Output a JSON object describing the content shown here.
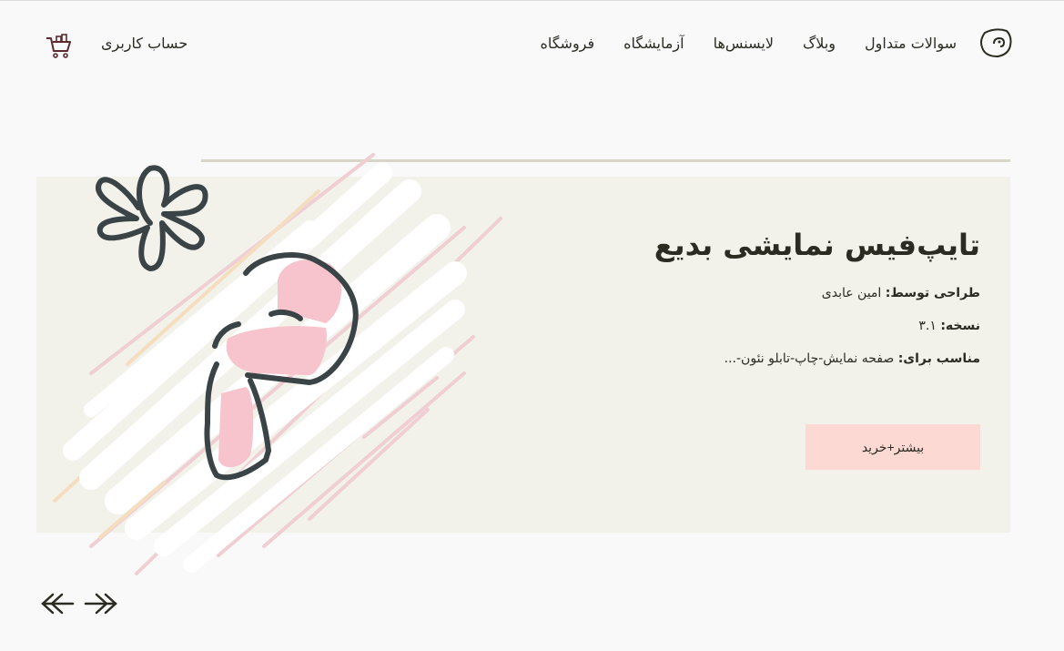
{
  "header": {
    "nav": [
      "فروشگاه",
      "آزمایشگاه",
      "لایسنس‌ها",
      "وبلاگ",
      "سوالات متداول"
    ],
    "account_label": "حساب کاربری"
  },
  "hero": {
    "title": "تایپ‌فیس نمایشی بدیع",
    "designer_key": "طراحی توسط:",
    "designer_value": "امین عابدی",
    "version_key": "نسخه:",
    "version_value": "۳.۱",
    "suited_key": "مناسب برای:",
    "suited_value": "صفحه نمایش-چاپ-تابلو نئون-...",
    "button_label": "بیشتر+خرید"
  },
  "colors": {
    "accent": "#fcd9d2",
    "card": "#f2f1ea",
    "dark": "#3a4346",
    "pink": "#f7c3cc"
  }
}
